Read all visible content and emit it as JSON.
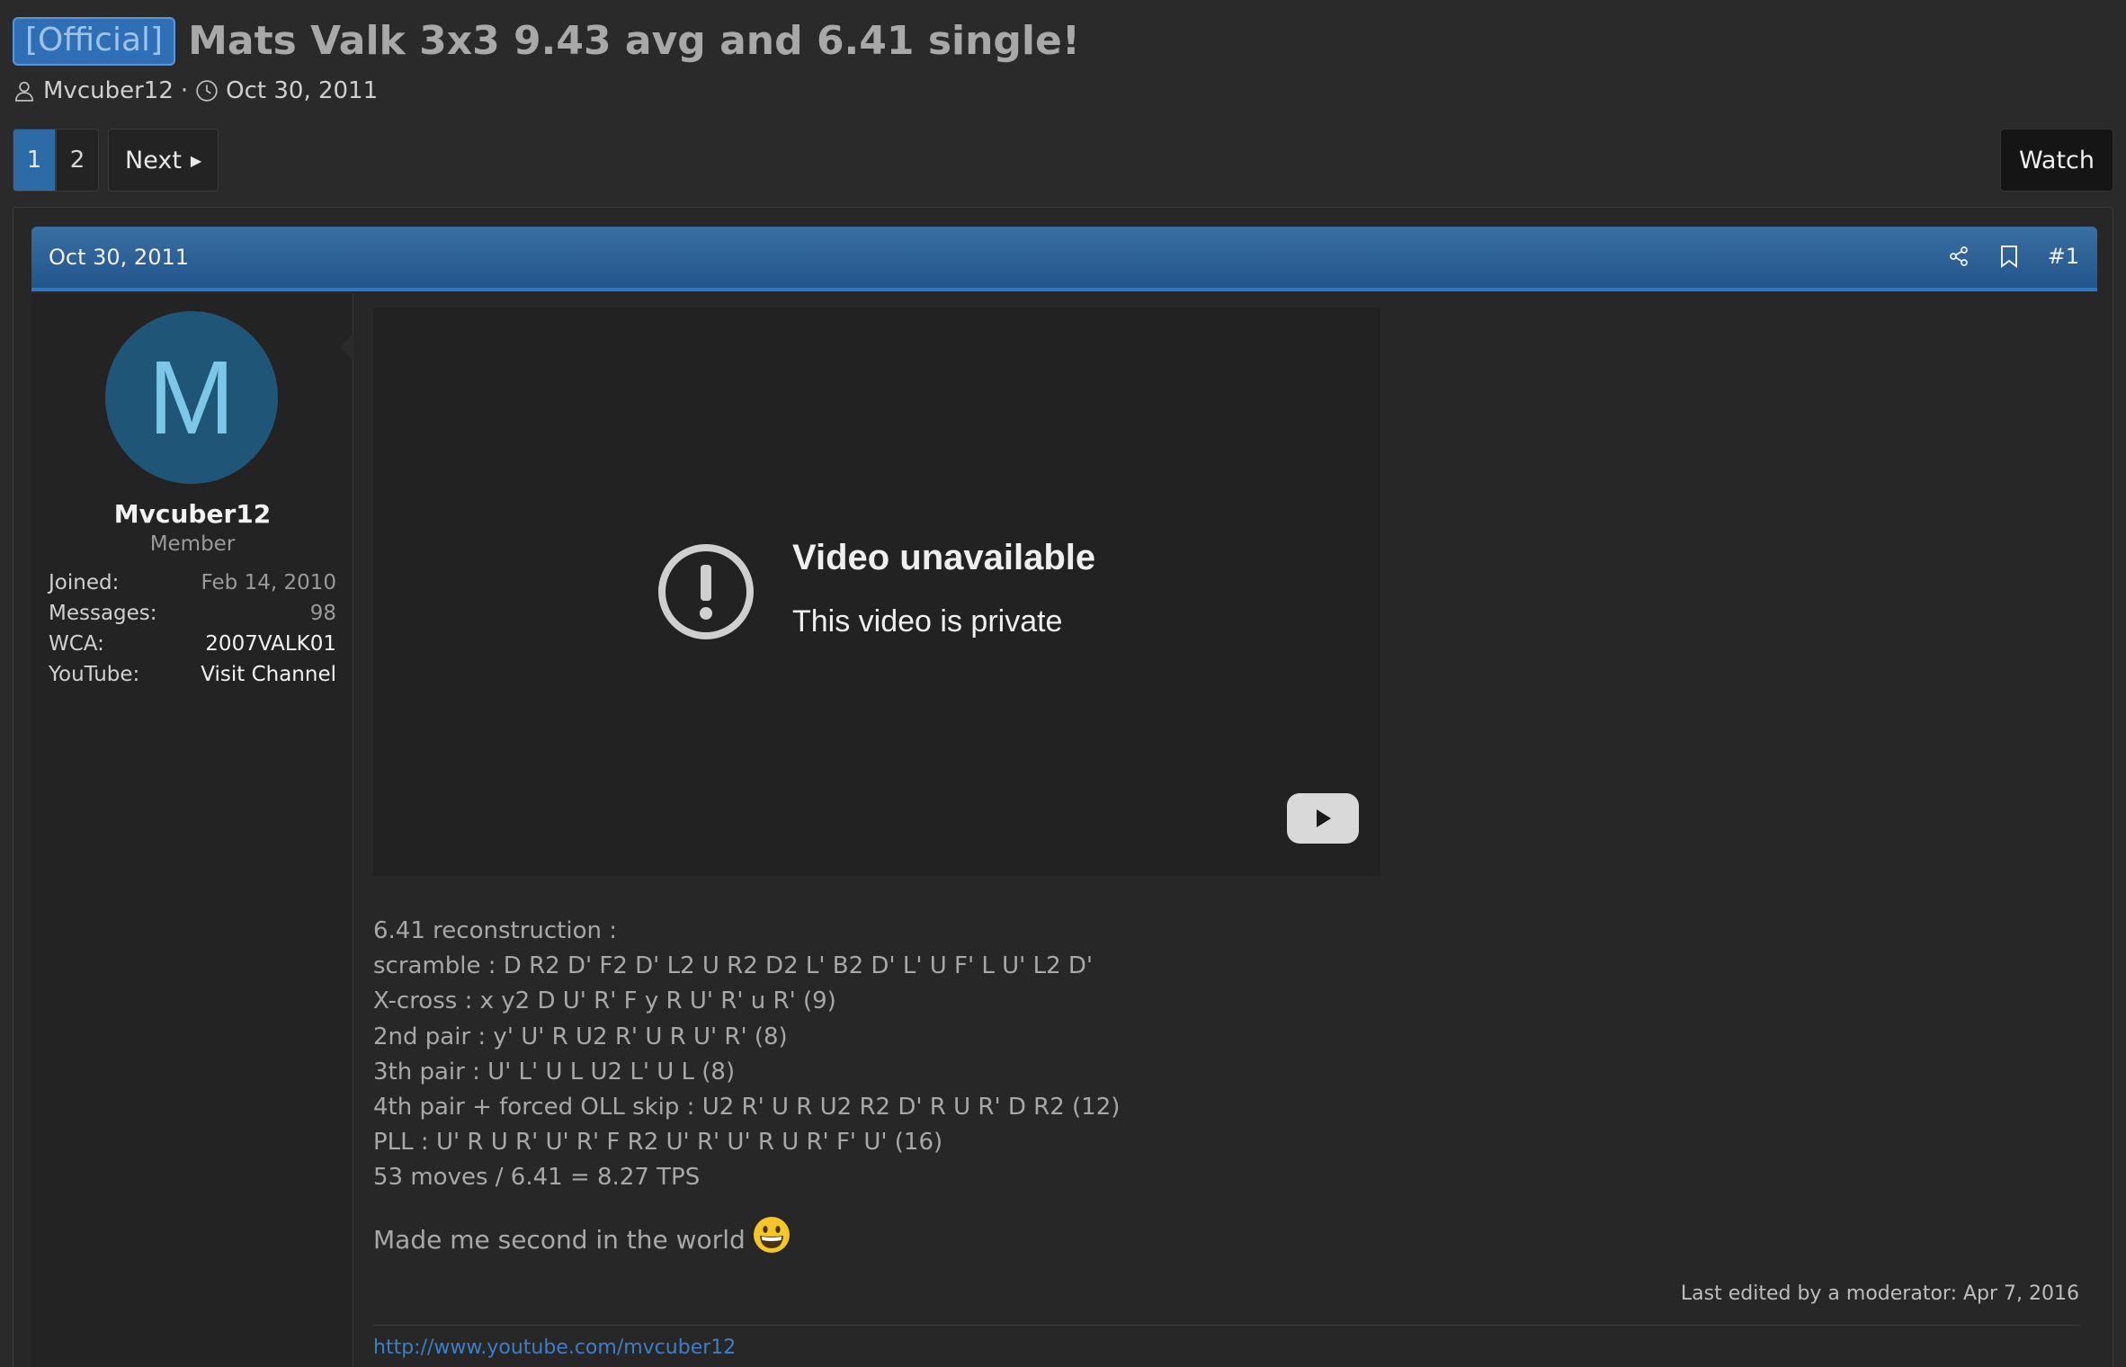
{
  "thread": {
    "prefix": "[Official]",
    "title": "Mats Valk 3x3 9.43 avg and 6.41 single!",
    "author": "Mvcuber12",
    "separator": "·",
    "date": "Oct 30, 2011"
  },
  "pagination": {
    "pages": [
      "1",
      "2"
    ],
    "current": "1",
    "next_label": "Next"
  },
  "watch_label": "Watch",
  "post": {
    "date": "Oct 30, 2011",
    "number": "#1",
    "user": {
      "avatar_letter": "M",
      "name": "Mvcuber12",
      "title": "Member",
      "stats": [
        {
          "label": "Joined:",
          "value": "Feb 14, 2010"
        },
        {
          "label": "Messages:",
          "value": "98"
        },
        {
          "label": "WCA:",
          "value": "2007VALK01"
        },
        {
          "label": "YouTube:",
          "value": "Visit Channel"
        }
      ]
    },
    "video": {
      "title": "Video unavailable",
      "subtitle": "This video is private"
    },
    "lines": [
      "6.41 reconstruction :",
      "scramble : D R2 D' F2 D' L2 U R2 D2 L' B2 D' L' U F' L U' L2 D'",
      "X-cross : x y2 D U' R' F y R U' R' u R' (9)",
      "2nd pair : y' U' R U2 R' U R U' R' (8)",
      "3th pair : U' L' U L U2 L' U L (8)",
      "4th pair + forced OLL skip : U2 R' U R U2 R2 D' R U R' D R2 (12)",
      "PLL : U' R U R' U' R' F R2 U' R' U' R U R' F' U' (16)",
      "53 moves / 6.41 = 8.27 TPS"
    ],
    "final_line": "Made me second in the world",
    "last_edited": "Last edited by a moderator: Apr 7, 2016",
    "signature_link": "http://www.youtube.com/mvcuber12"
  },
  "colors": {
    "accent": "#2d6ba6",
    "link": "#3d7ec4",
    "avatar_bg": "#1f5576",
    "avatar_fg": "#7cc7e8"
  }
}
